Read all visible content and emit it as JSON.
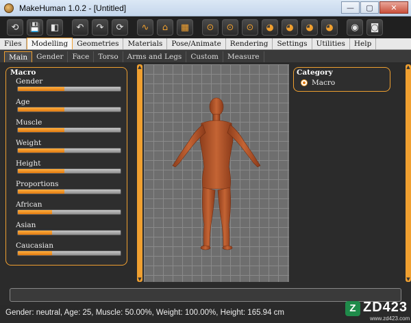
{
  "window": {
    "title": "MakeHuman 1.0.2 - [Untitled]"
  },
  "window_controls": {
    "minimize": "—",
    "maximize": "▢",
    "close": "✕"
  },
  "toolbar": {
    "buttons": [
      {
        "name": "undo-all-button",
        "glyph": "⟲"
      },
      {
        "name": "save-button",
        "glyph": "💾"
      },
      {
        "name": "load-button",
        "glyph": "◧"
      },
      {
        "name": "undo-button",
        "glyph": "↶"
      },
      {
        "name": "redo-button",
        "glyph": "↷"
      },
      {
        "name": "reset-button",
        "glyph": "⟳"
      },
      {
        "name": "smooth-button",
        "glyph": "∿"
      },
      {
        "name": "wireframe-button",
        "glyph": "⌂"
      },
      {
        "name": "background-button",
        "glyph": "▦"
      },
      {
        "name": "front-view-button",
        "glyph": "⊙"
      },
      {
        "name": "back-view-button",
        "glyph": "⊙"
      },
      {
        "name": "left-view-button",
        "glyph": "⊙"
      },
      {
        "name": "right-view-button",
        "glyph": "◕"
      },
      {
        "name": "top-view-button",
        "glyph": "◕"
      },
      {
        "name": "bottom-view-button",
        "glyph": "◕"
      },
      {
        "name": "reset-camera-button",
        "glyph": "◕"
      },
      {
        "name": "grid-button",
        "glyph": "◉"
      },
      {
        "name": "screenshot-button",
        "glyph": "◙"
      }
    ]
  },
  "menu_tabs": [
    "Files",
    "Modelling",
    "Geometries",
    "Materials",
    "Pose/Animate",
    "Rendering",
    "Settings",
    "Utilities",
    "Help"
  ],
  "menu_active": "Modelling",
  "sub_tabs": [
    "Main",
    "Gender",
    "Face",
    "Torso",
    "Arms and Legs",
    "Custom",
    "Measure"
  ],
  "sub_active": "Main",
  "macro": {
    "title": "Macro",
    "sliders": [
      {
        "label": "Gender",
        "value": 0.45
      },
      {
        "label": "Age",
        "value": 0.45
      },
      {
        "label": "Muscle",
        "value": 0.45
      },
      {
        "label": "Weight",
        "value": 0.45
      },
      {
        "label": "Height",
        "value": 0.45
      },
      {
        "label": "Proportions",
        "value": 0.45
      },
      {
        "label": "African",
        "value": 0.33
      },
      {
        "label": "Asian",
        "value": 0.33
      },
      {
        "label": "Caucasian",
        "value": 0.33
      }
    ]
  },
  "category": {
    "title": "Category",
    "selected": "Macro"
  },
  "status": "Gender: neutral, Age: 25, Muscle: 50.00%, Weight: 100.00%, Height: 165.94 cm",
  "watermark": {
    "logo": "Z",
    "text": "ZD423",
    "url": "www.zd423.com"
  },
  "colors": {
    "accent": "#f0a030",
    "skin": "#b8582f"
  }
}
